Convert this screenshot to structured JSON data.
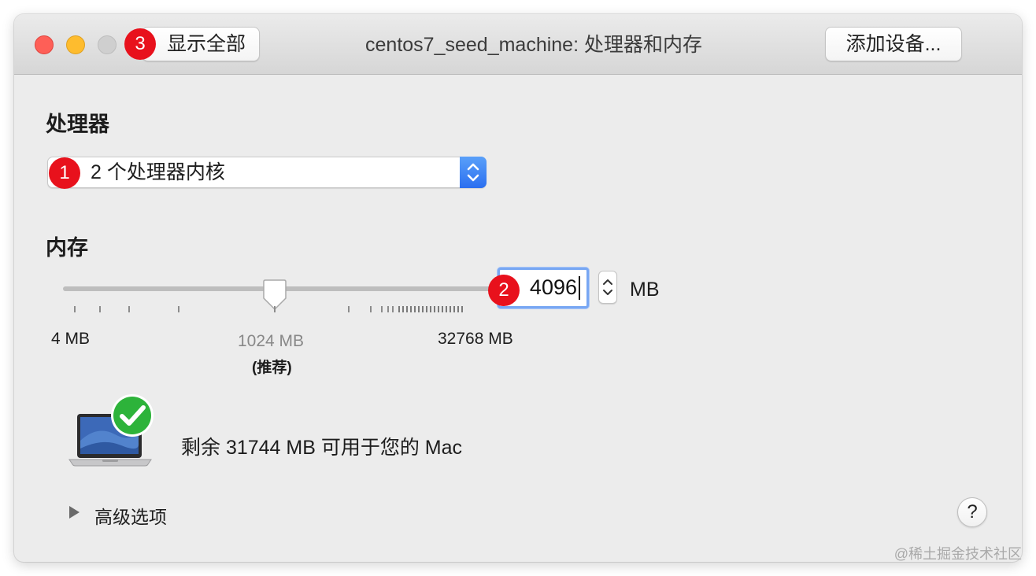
{
  "window": {
    "title": "centos7_seed_machine: 处理器和内存",
    "show_all_label": "显示全部",
    "add_device_label": "添加设备..."
  },
  "processor": {
    "section_title": "处理器",
    "selected_value": "2 个处理器内核"
  },
  "memory": {
    "section_title": "内存",
    "value": "4096",
    "unit": "MB",
    "slider": {
      "min_label": "4 MB",
      "recommended_label": "1024 MB",
      "recommended_note": "(推荐)",
      "max_label": "32768 MB"
    }
  },
  "availability": {
    "text": "剩余 31744 MB 可用于您的 Mac"
  },
  "advanced": {
    "label": "高级选项"
  },
  "help": {
    "label": "?"
  },
  "annotations": {
    "badge_1": "1",
    "badge_2": "2",
    "badge_3": "3"
  },
  "watermark": "@稀土掘金技术社区",
  "colors": {
    "badge": "#e8111c",
    "accent_blue": "#2b6ff0",
    "focus_ring": "#78a7f3",
    "check_green": "#2db33a"
  },
  "icons": {
    "popup_arrows": "chevron-up-down-icon",
    "stepper": "chevron-up-down-icon",
    "disclosure": "triangle-right-icon",
    "laptop": "laptop-icon",
    "check": "checkmark-icon"
  }
}
